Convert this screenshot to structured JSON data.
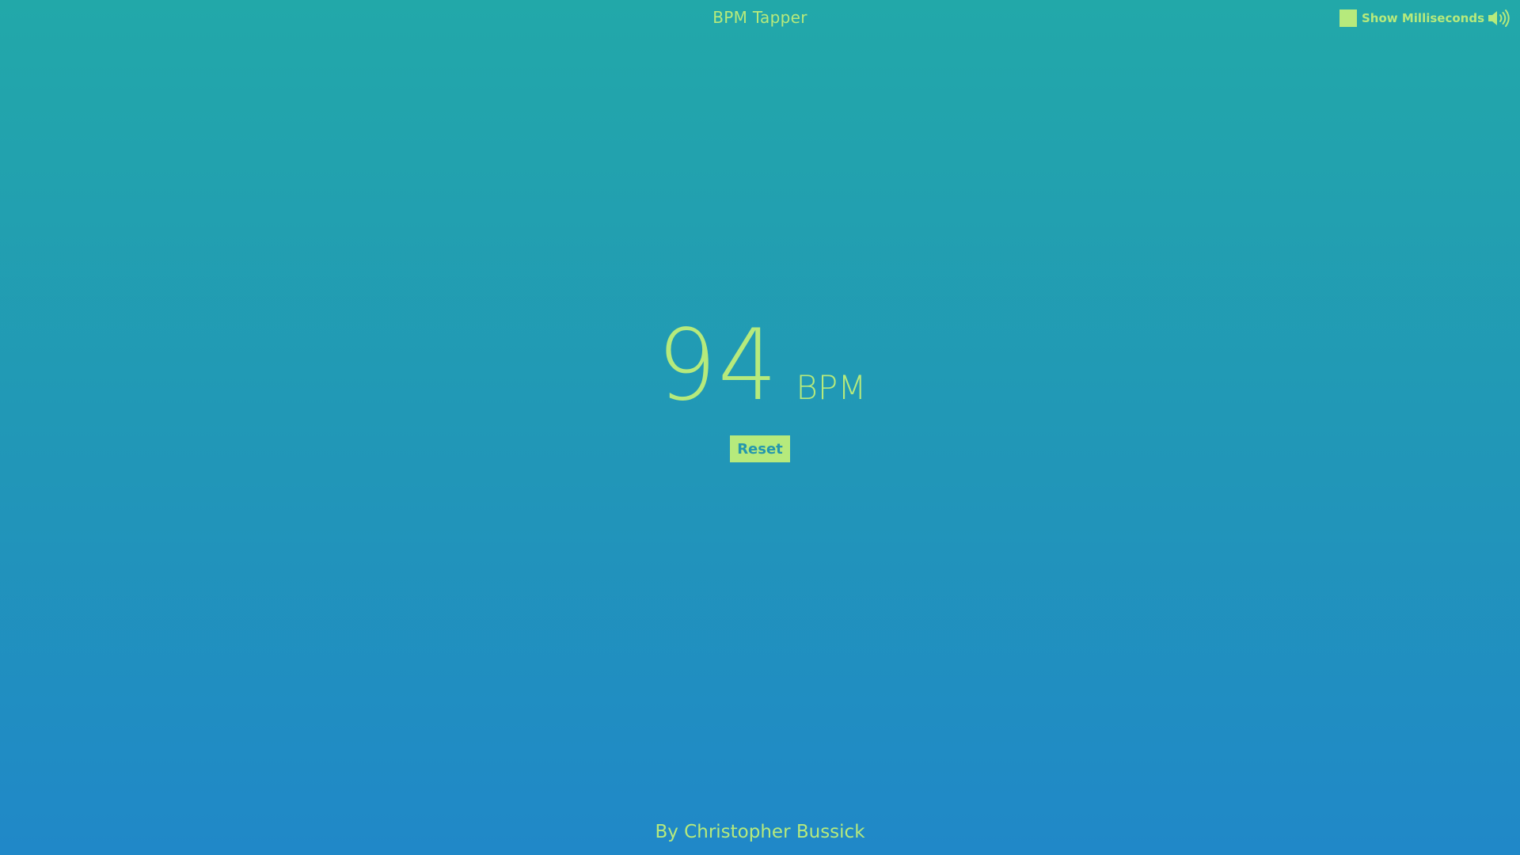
{
  "app": {
    "title": "BPM Tapper"
  },
  "options": {
    "show_milliseconds_label": "Show Milliseconds",
    "show_milliseconds_checked": true,
    "sound_icon": "speaker-volume-icon"
  },
  "tempo": {
    "value": "94",
    "unit": "BPM"
  },
  "controls": {
    "reset_label": "Reset"
  },
  "footer": {
    "credit": "By Christopher Bussick"
  },
  "colors": {
    "accent": "#b6ea7c",
    "gradient_top": "#22a8a9",
    "gradient_bottom": "#2088c8"
  }
}
